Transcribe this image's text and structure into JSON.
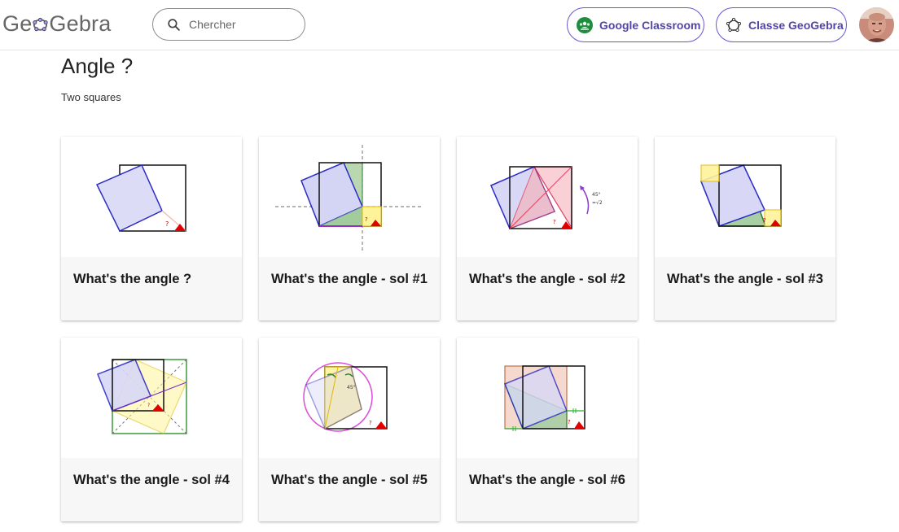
{
  "header": {
    "logo_text": "GeoGebra",
    "search_placeholder": "Chercher",
    "classroom_label": "Google Classroom",
    "classe_label": "Classe GeoGebra"
  },
  "page": {
    "title": "Angle ?",
    "subtitle": "Two squares"
  },
  "cards": [
    {
      "title": "What's the angle ?"
    },
    {
      "title": "What's the angle - sol #1"
    },
    {
      "title": "What's the angle - sol #2"
    },
    {
      "title": "What's the angle - sol #3"
    },
    {
      "title": "What's the angle - sol #4"
    },
    {
      "title": "What's the angle - sol #5"
    },
    {
      "title": "What's the angle - sol #6"
    }
  ],
  "thumb_text": {
    "question_mark": "?",
    "angle_45": "45°",
    "sqrt_text": "=√2"
  },
  "colors": {
    "accent": "#6557d2",
    "square_blue": "#2b2bc6",
    "triangle_red": "#e00000"
  }
}
